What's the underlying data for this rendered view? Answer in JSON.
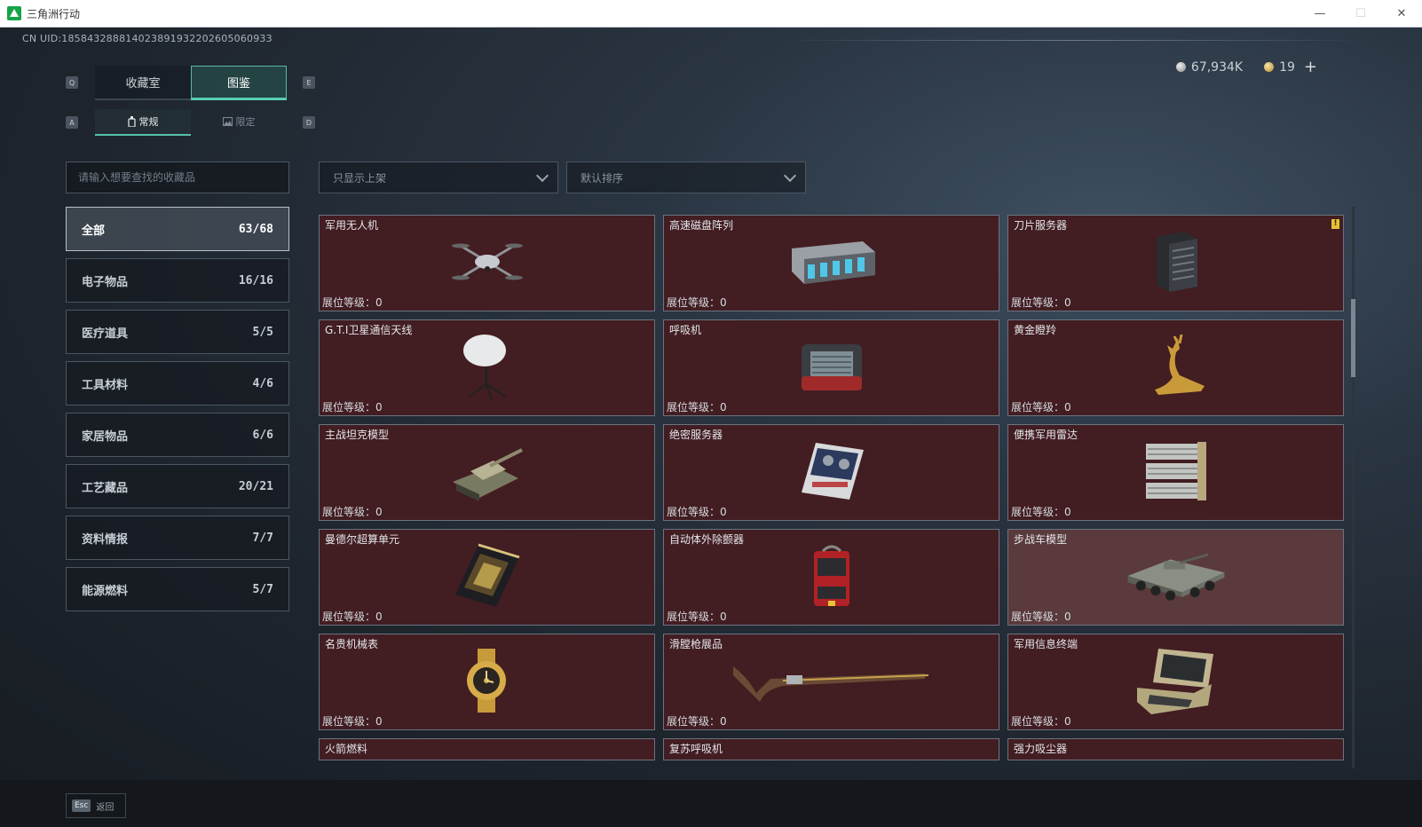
{
  "window": {
    "title": "三角洲行动",
    "minimize": "—",
    "maximize": "☐",
    "close": "✕"
  },
  "uid": "CN UID:1858432888140238919322026050609​33",
  "currency": {
    "silver": "67,934K",
    "gold": "19",
    "add": "+"
  },
  "keys": {
    "q": "Q",
    "e": "E",
    "a": "A",
    "d": "D"
  },
  "tabs": [
    {
      "label": "收藏室"
    },
    {
      "label": "图鉴"
    }
  ],
  "subtabs": [
    {
      "label": "常规"
    },
    {
      "label": "限定"
    }
  ],
  "search": {
    "placeholder": "请输入想要查找的收藏品"
  },
  "filters": {
    "shelf": "只显示上架",
    "sort": "默认排序"
  },
  "categories": [
    {
      "label": "全部",
      "count": "63/68"
    },
    {
      "label": "电子物品",
      "count": "16/16"
    },
    {
      "label": "医疗道具",
      "count": "5/5"
    },
    {
      "label": "工具材料",
      "count": "4/6"
    },
    {
      "label": "家居物品",
      "count": "6/6"
    },
    {
      "label": "工艺藏品",
      "count": "20/21"
    },
    {
      "label": "资料情报",
      "count": "7/7"
    },
    {
      "label": "能源燃料",
      "count": "5/7"
    }
  ],
  "level_label": "展位等级：0",
  "items": [
    {
      "name": "军用无人机",
      "icon": "drone-icon"
    },
    {
      "name": "高速磁盘阵列",
      "icon": "disk-array-icon"
    },
    {
      "name": "刀片服务器",
      "icon": "blade-server-icon",
      "badge": "!"
    },
    {
      "name": "G.T.I卫星通信天线",
      "icon": "satellite-dish-icon"
    },
    {
      "name": "呼吸机",
      "icon": "ventilator-icon"
    },
    {
      "name": "黄金瞪羚",
      "icon": "golden-gazelle-icon"
    },
    {
      "name": "主战坦克模型",
      "icon": "tank-model-icon"
    },
    {
      "name": "绝密服务器",
      "icon": "secret-server-icon"
    },
    {
      "name": "便携军用雷达",
      "icon": "radar-icon"
    },
    {
      "name": "曼德尔超算单元",
      "icon": "supercompute-unit-icon"
    },
    {
      "name": "自动体外除颤器",
      "icon": "defibrillator-icon"
    },
    {
      "name": "步战车模型",
      "icon": "ifv-model-icon"
    },
    {
      "name": "名贵机械表",
      "icon": "watch-icon"
    },
    {
      "name": "滑膛枪展品",
      "icon": "musket-icon"
    },
    {
      "name": "军用信息终端",
      "icon": "info-terminal-icon"
    }
  ],
  "partial_items": [
    {
      "name": "火箭燃料"
    },
    {
      "name": "复苏呼吸机"
    },
    {
      "name": "强力吸尘器"
    }
  ],
  "footer": {
    "esc_key": "Esc",
    "back": "返回"
  }
}
